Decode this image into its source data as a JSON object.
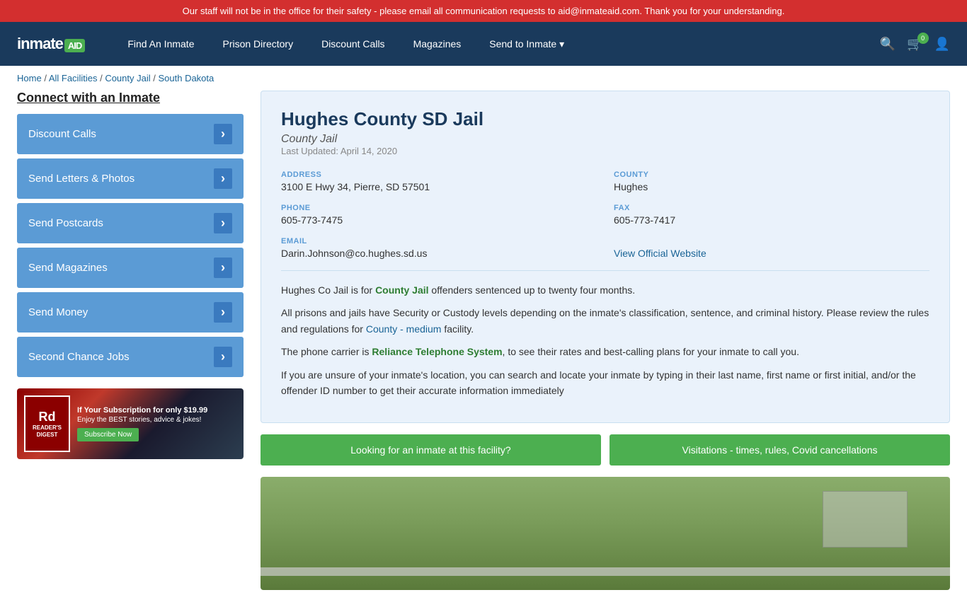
{
  "alert": {
    "text": "Our staff will not be in the office for their safety - please email all communication requests to aid@inmateaid.com.  Thank you for your understanding."
  },
  "header": {
    "logo_brand": "inmate",
    "logo_aid": "AID",
    "nav_items": [
      {
        "label": "Find An Inmate",
        "id": "find-inmate"
      },
      {
        "label": "Prison Directory",
        "id": "prison-directory"
      },
      {
        "label": "Discount Calls",
        "id": "discount-calls"
      },
      {
        "label": "Magazines",
        "id": "magazines"
      },
      {
        "label": "Send to Inmate",
        "id": "send-to-inmate"
      }
    ],
    "cart_count": "0"
  },
  "breadcrumb": {
    "items": [
      "Home",
      "All Facilities",
      "County Jail",
      "South Dakota"
    ]
  },
  "sidebar": {
    "title": "Connect with an Inmate",
    "buttons": [
      {
        "label": "Discount Calls",
        "id": "discount-calls-btn"
      },
      {
        "label": "Send Letters & Photos",
        "id": "send-letters-btn"
      },
      {
        "label": "Send Postcards",
        "id": "send-postcards-btn"
      },
      {
        "label": "Send Magazines",
        "id": "send-magazines-btn"
      },
      {
        "label": "Send Money",
        "id": "send-money-btn"
      },
      {
        "label": "Second Chance Jobs",
        "id": "second-chance-btn"
      }
    ],
    "ad": {
      "brand": "READER'S\nDIGEST",
      "rd_short": "Rd",
      "title": "If Your Subscription for only $19.99",
      "subtitle": "Enjoy the BEST stories, advice & jokes!",
      "subscribe_label": "Subscribe Now"
    }
  },
  "facility": {
    "name": "Hughes County SD Jail",
    "type": "County Jail",
    "last_updated": "Last Updated: April 14, 2020",
    "address_label": "ADDRESS",
    "address_value": "3100 E Hwy 34, Pierre, SD 57501",
    "county_label": "COUNTY",
    "county_value": "Hughes",
    "phone_label": "PHONE",
    "phone_value": "605-773-7475",
    "fax_label": "FAX",
    "fax_value": "605-773-7417",
    "email_label": "EMAIL",
    "email_value": "Darin.Johnson@co.hughes.sd.us",
    "website_label": "View Official Website",
    "desc1": "Hughes Co Jail is for County Jail offenders sentenced up to twenty four months.",
    "desc2": "All prisons and jails have Security or Custody levels depending on the inmate's classification, sentence, and criminal history. Please review the rules and regulations for County - medium facility.",
    "desc3": "The phone carrier is Reliance Telephone System, to see their rates and best-calling plans for your inmate to call you.",
    "desc4": "If you are unsure of your inmate's location, you can search and locate your inmate by typing in their last name, first name or first initial, and/or the offender ID number to get their accurate information immediately",
    "btn_looking": "Looking for an inmate at this facility?",
    "btn_visitations": "Visitations - times, rules, Covid cancellations"
  }
}
